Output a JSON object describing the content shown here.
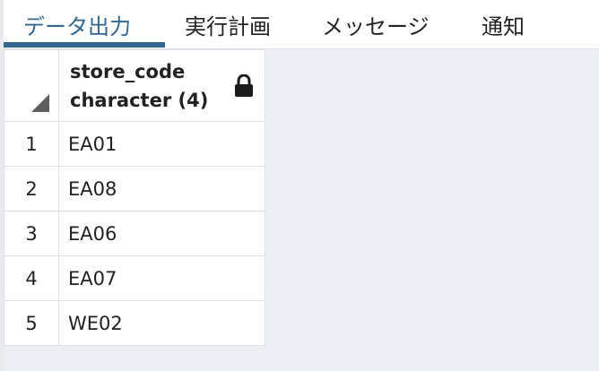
{
  "tabs": [
    {
      "label": "データ出力",
      "active": true
    },
    {
      "label": "実行計画",
      "active": false
    },
    {
      "label": "メッセージ",
      "active": false
    },
    {
      "label": "通知",
      "active": false
    }
  ],
  "colors": {
    "accent": "#326690",
    "grid_background": "#ebeef3",
    "border": "#dde0e6",
    "text": "#222222"
  },
  "grid": {
    "columns": [
      {
        "name": "store_code",
        "type": "character (4)",
        "icon": "lock-icon"
      }
    ],
    "rows": [
      {
        "num": "1",
        "values": [
          "EA01"
        ]
      },
      {
        "num": "2",
        "values": [
          "EA08"
        ]
      },
      {
        "num": "3",
        "values": [
          "EA06"
        ]
      },
      {
        "num": "4",
        "values": [
          "EA07"
        ]
      },
      {
        "num": "5",
        "values": [
          "WE02"
        ]
      }
    ]
  }
}
